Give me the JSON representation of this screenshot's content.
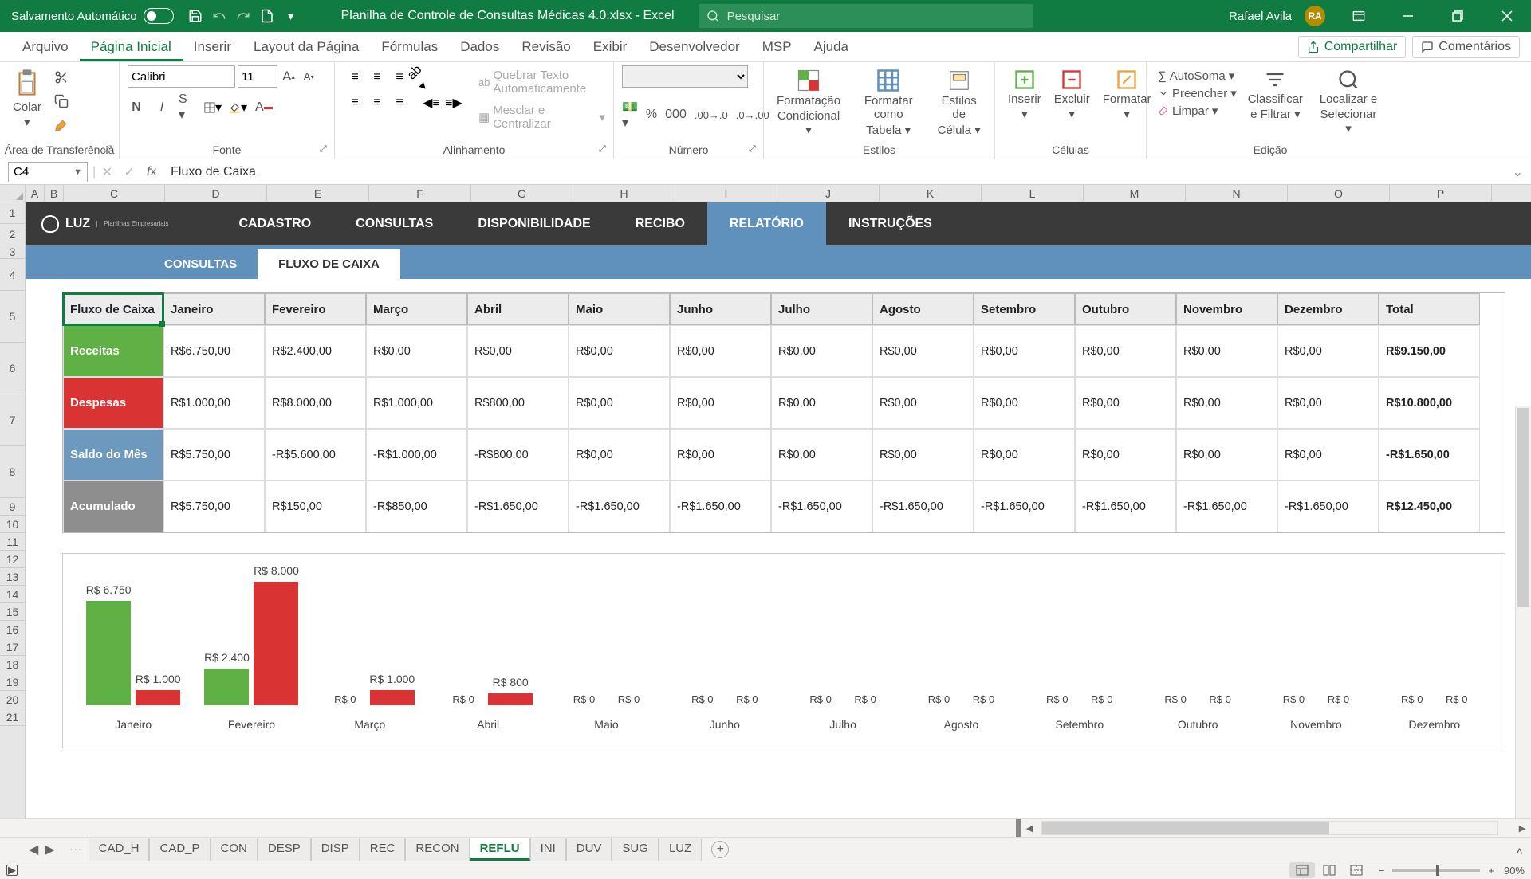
{
  "titlebar": {
    "autosave_label": "Salvamento Automático",
    "filename": "Planilha de Controle de Consultas Médicas 4.0.xlsx  -  Excel",
    "search_placeholder": "Pesquisar",
    "user_name": "Rafael Avila",
    "user_initials": "RA"
  },
  "ribbon_tabs": [
    "Arquivo",
    "Página Inicial",
    "Inserir",
    "Layout da Página",
    "Fórmulas",
    "Dados",
    "Revisão",
    "Exibir",
    "Desenvolvedor",
    "MSP",
    "Ajuda"
  ],
  "ribbon": {
    "share": "Compartilhar",
    "comments": "Comentários",
    "paste": "Colar",
    "clipboard": "Área de Transferência",
    "font_name": "Calibri",
    "font_size": "11",
    "font": "Fonte",
    "alignment": "Alinhamento",
    "wrap_text": "Quebrar Texto Automaticamente",
    "merge": "Mesclar e Centralizar",
    "number": "Número",
    "styles": "Estilos",
    "cond_fmt1": "Formatação",
    "cond_fmt2": "Condicional",
    "fmt_as_t1": "Formatar como",
    "fmt_as_t2": "Tabela",
    "cell_s1": "Estilos de",
    "cell_s2": "Célula",
    "cells": "Células",
    "insert": "Inserir",
    "delete": "Excluir",
    "format": "Formatar",
    "editing": "Edição",
    "autosum": "AutoSoma",
    "fill": "Preencher",
    "clear": "Limpar",
    "sort1": "Classificar",
    "sort2": "e Filtrar",
    "find1": "Localizar e",
    "find2": "Selecionar"
  },
  "formula_bar": {
    "cell_ref": "C4",
    "formula": "Fluxo de Caixa"
  },
  "columns": [
    "A",
    "B",
    "C",
    "D",
    "E",
    "F",
    "G",
    "H",
    "I",
    "J",
    "K",
    "L",
    "M",
    "N",
    "O",
    "P"
  ],
  "rows": [
    1,
    2,
    3,
    4,
    5,
    6,
    7,
    8,
    9,
    10,
    11,
    12,
    13,
    14,
    15,
    16,
    17,
    18,
    19,
    20,
    21
  ],
  "nav_items": [
    "CADASTRO",
    "CONSULTAS",
    "DISPONIBILIDADE",
    "RECIBO",
    "RELATÓRIO",
    "INSTRUÇÕES"
  ],
  "sub_tabs": [
    "CONSULTAS",
    "FLUXO DE CAIXA"
  ],
  "table": {
    "headers": [
      "Fluxo de Caixa",
      "Janeiro",
      "Fevereiro",
      "Março",
      "Abril",
      "Maio",
      "Junho",
      "Julho",
      "Agosto",
      "Setembro",
      "Outubro",
      "Novembro",
      "Dezembro",
      "Total"
    ],
    "rows": [
      {
        "label": "Receitas",
        "class": "receitas",
        "values": [
          "R$6.750,00",
          "R$2.400,00",
          "R$0,00",
          "R$0,00",
          "R$0,00",
          "R$0,00",
          "R$0,00",
          "R$0,00",
          "R$0,00",
          "R$0,00",
          "R$0,00",
          "R$0,00",
          "R$9.150,00"
        ]
      },
      {
        "label": "Despesas",
        "class": "despesas",
        "values": [
          "R$1.000,00",
          "R$8.000,00",
          "R$1.000,00",
          "R$800,00",
          "R$0,00",
          "R$0,00",
          "R$0,00",
          "R$0,00",
          "R$0,00",
          "R$0,00",
          "R$0,00",
          "R$0,00",
          "R$10.800,00"
        ]
      },
      {
        "label": "Saldo do Mês",
        "class": "saldo",
        "values": [
          "R$5.750,00",
          "-R$5.600,00",
          "-R$1.000,00",
          "-R$800,00",
          "R$0,00",
          "R$0,00",
          "R$0,00",
          "R$0,00",
          "R$0,00",
          "R$0,00",
          "R$0,00",
          "R$0,00",
          "-R$1.650,00"
        ]
      },
      {
        "label": "Acumulado",
        "class": "acumulado",
        "values": [
          "R$5.750,00",
          "R$150,00",
          "-R$850,00",
          "-R$1.650,00",
          "-R$1.650,00",
          "-R$1.650,00",
          "-R$1.650,00",
          "-R$1.650,00",
          "-R$1.650,00",
          "-R$1.650,00",
          "-R$1.650,00",
          "-R$1.650,00",
          "R$12.450,00"
        ]
      }
    ]
  },
  "chart_data": {
    "type": "bar",
    "categories": [
      "Janeiro",
      "Fevereiro",
      "Março",
      "Abril",
      "Maio",
      "Junho",
      "Julho",
      "Agosto",
      "Setembro",
      "Outubro",
      "Novembro",
      "Dezembro"
    ],
    "series": [
      {
        "name": "Receitas",
        "color": "#5fb146",
        "values": [
          6750,
          2400,
          0,
          0,
          0,
          0,
          0,
          0,
          0,
          0,
          0,
          0
        ],
        "labels": [
          "R$ 6.750",
          "R$ 2.400",
          "R$ 0",
          "R$ 0",
          "R$ 0",
          "R$ 0",
          "R$ 0",
          "R$ 0",
          "R$ 0",
          "R$ 0",
          "R$ 0",
          "R$ 0"
        ]
      },
      {
        "name": "Despesas",
        "color": "#d93333",
        "values": [
          1000,
          8000,
          1000,
          800,
          0,
          0,
          0,
          0,
          0,
          0,
          0,
          0
        ],
        "labels": [
          "R$ 1.000",
          "R$ 8.000",
          "R$ 1.000",
          "R$ 800",
          "R$ 0",
          "R$ 0",
          "R$ 0",
          "R$ 0",
          "R$ 0",
          "R$ 0",
          "R$ 0",
          "R$ 0"
        ]
      }
    ],
    "ylim": [
      0,
      8000
    ]
  },
  "sheet_tabs": [
    "CAD_H",
    "CAD_P",
    "CON",
    "DESP",
    "DISP",
    "REC",
    "RECON",
    "REFLU",
    "INI",
    "DUV",
    "SUG",
    "LUZ"
  ],
  "active_sheet_tab": "REFLU",
  "status": {
    "zoom": "90%"
  },
  "logo_sub": "Planilhas\nEmpresariais"
}
